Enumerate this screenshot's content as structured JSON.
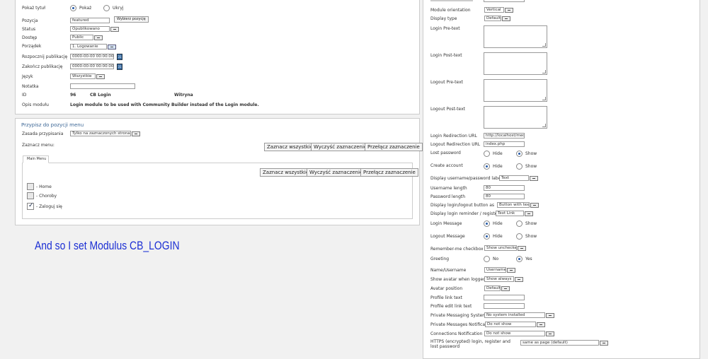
{
  "left": {
    "details": {
      "show_title": {
        "label": "Pokaż tytuł",
        "opt_show": "Pokaż",
        "opt_hide": "Ukryj"
      },
      "position": {
        "label": "Pozycja",
        "value": "featured",
        "button": "Wybierz pozycję"
      },
      "status": {
        "label": "Status",
        "value": "Opublikowano"
      },
      "access": {
        "label": "Dostęp",
        "value": "Public"
      },
      "ordering": {
        "label": "Porządek",
        "value": "1. Logowanie"
      },
      "publish_up": {
        "label": "Rozpocznij publikację",
        "value": "0000-00-00 00:00:00"
      },
      "publish_down": {
        "label": "Zakończ publikację",
        "value": "0000-00-00 00:00:00"
      },
      "language": {
        "label": "Język",
        "value": "Wszystkie"
      },
      "note": {
        "label": "Notatka",
        "value": ""
      },
      "id": {
        "label": "ID",
        "value": "96",
        "name": "CB Login",
        "site": "Witryna"
      },
      "desc": {
        "label": "Opis modułu",
        "value": "Login module to be used with Community Builder instead of the Login module."
      }
    },
    "menu": {
      "legend": "Przypisz do pozycji menu",
      "assign": {
        "label": "Zasada przypisania",
        "value": "Tylko na zaznaczonych stronach"
      },
      "select_label": "Zaznacz menu:",
      "btn_select_all": "Zaznacz wszystkie",
      "btn_clear": "Wyczyść zaznaczenie",
      "btn_toggle": "Przełącz zaznaczenie",
      "tab": "Main Menu",
      "items": [
        {
          "label": "- Home",
          "checked": false
        },
        {
          "label": "- Choroby",
          "checked": false
        },
        {
          "label": "- Zaloguj się",
          "checked": true
        }
      ]
    },
    "annotation": {
      "text": "And so I set Modulus CB_LOGIN",
      "color": "#1c2fd4"
    }
  },
  "right": {
    "orientation": {
      "label": "Module orientation",
      "value": "Vertical"
    },
    "display_type": {
      "label": "Display type",
      "value": "Default"
    },
    "login_pre": {
      "label": "Login Pre-text"
    },
    "login_post": {
      "label": "Login Post-text"
    },
    "logout_pre": {
      "label": "Logout Pre-text"
    },
    "logout_post": {
      "label": "Logout Post-text"
    },
    "login_redirect": {
      "label": "Login Redirection URL",
      "value": "http://localhost/medicic"
    },
    "logout_redirect": {
      "label": "Logout Redirection URL",
      "value": "index.php"
    },
    "lost_password": {
      "label": "Lost password",
      "opt_a": "Hide",
      "opt_b": "Show"
    },
    "create_account": {
      "label": "Create account",
      "opt_a": "Hide",
      "opt_b": "Show"
    },
    "display_labels": {
      "label": "Display username/password labels as",
      "value": "Text"
    },
    "username_length": {
      "label": "Username length",
      "value": "80"
    },
    "password_length": {
      "label": "Password length",
      "value": "80"
    },
    "login_button": {
      "label": "Display login/logout button as",
      "value": "Button with text"
    },
    "reminder": {
      "label": "Display login reminder / register as",
      "value": "Text Link"
    },
    "login_message": {
      "label": "Login Message",
      "opt_a": "Hide",
      "opt_b": "Show"
    },
    "logout_message": {
      "label": "Logout Message",
      "opt_a": "Hide",
      "opt_b": "Show"
    },
    "remember": {
      "label": "Remember-me checkbox",
      "value": "Show unchecked"
    },
    "greeting": {
      "label": "Greeting",
      "opt_a": "No",
      "opt_b": "Yes"
    },
    "name_username": {
      "label": "Name/Username",
      "value": "Username"
    },
    "avatar_show": {
      "label": "Show avatar when logged-in",
      "value": "Show always"
    },
    "avatar_pos": {
      "label": "Avatar position",
      "value": "Default"
    },
    "profile_link": {
      "label": "Profile link text",
      "value": ""
    },
    "profile_edit": {
      "label": "Profile edit link text",
      "value": ""
    },
    "pms": {
      "label": "Private Messaging System",
      "value": "No system installed"
    },
    "pms_notif": {
      "label": "Private Messages Notification",
      "value": "Do not show"
    },
    "conn_notif": {
      "label": "Connections Notification",
      "value": "Do not show"
    },
    "https": {
      "label": "HTTPS (encrypted) login, register and lost password",
      "value": "same as page (default)"
    }
  }
}
